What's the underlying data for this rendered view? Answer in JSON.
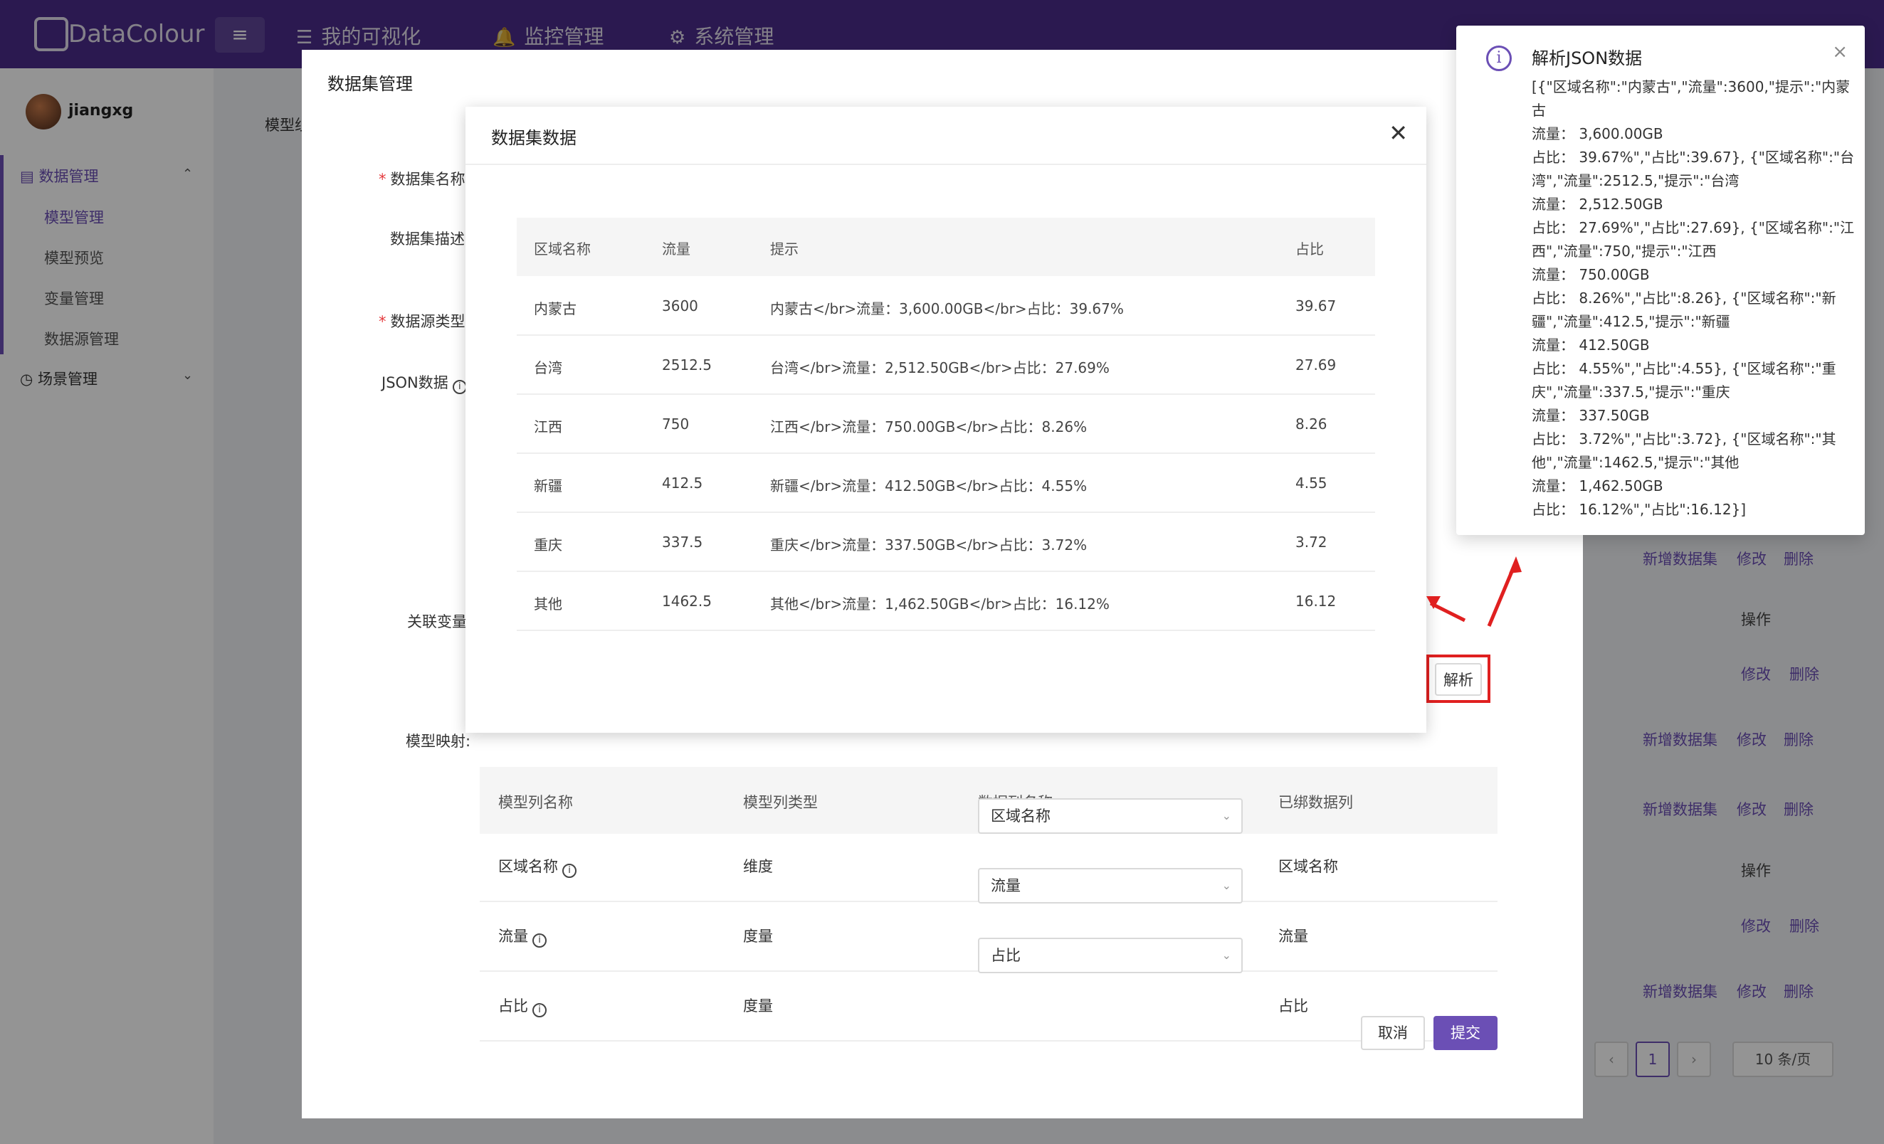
{
  "app": {
    "logo_text": "DataColour",
    "menu_toggle_icon": "≡",
    "nav": [
      {
        "icon": "☰",
        "label": "我的可视化"
      },
      {
        "icon": "🔔",
        "label": "监控管理"
      },
      {
        "icon": "⚙",
        "label": "系统管理"
      }
    ]
  },
  "sidebar": {
    "username": "jiangxg",
    "groups": [
      {
        "label": "数据管理",
        "icon": "▤"
      },
      {
        "label": "场景管理",
        "icon": "◷"
      }
    ],
    "items": [
      "模型管理",
      "模型预览",
      "变量管理",
      "数据源管理"
    ]
  },
  "background": {
    "breadcrumb": "模型组",
    "links": {
      "add_dataset": "新增数据集",
      "edit": "修改",
      "delete": "删除"
    },
    "op_header": "操作",
    "page": "1",
    "page_size": "10 条/页"
  },
  "outer_modal": {
    "title": "数据集管理",
    "labels": {
      "dataset_name": "数据集名称",
      "dataset_desc": "数据集描述",
      "datasource_type": "数据源类型",
      "json_data": "JSON数据",
      "related_var": "关联变量",
      "model_mapping": "模型映射:"
    },
    "parse_button": "解析",
    "mapping": {
      "headers": [
        "模型列名称",
        "模型列类型",
        "数据列名称",
        "已绑数据列"
      ],
      "rows": [
        {
          "name": "区域名称",
          "type": "维度",
          "select": "区域名称",
          "bound": "区域名称"
        },
        {
          "name": "流量",
          "type": "度量",
          "select": "流量",
          "bound": "流量"
        },
        {
          "name": "占比",
          "type": "度量",
          "select": "占比",
          "bound": "占比"
        }
      ]
    },
    "cancel": "取消",
    "submit": "提交"
  },
  "inner_modal": {
    "title": "数据集数据",
    "close": "✕",
    "headers": [
      "区域名称",
      "流量",
      "提示",
      "占比"
    ],
    "rows": [
      {
        "region": "内蒙古",
        "flow": "3600",
        "tip": "内蒙古</br>流量：3,600.00GB</br>占比：39.67%",
        "ratio": "39.67"
      },
      {
        "region": "台湾",
        "flow": "2512.5",
        "tip": "台湾</br>流量：2,512.50GB</br>占比：27.69%",
        "ratio": "27.69"
      },
      {
        "region": "江西",
        "flow": "750",
        "tip": "江西</br>流量：750.00GB</br>占比：8.26%",
        "ratio": "8.26"
      },
      {
        "region": "新疆",
        "flow": "412.5",
        "tip": "新疆</br>流量：412.50GB</br>占比：4.55%",
        "ratio": "4.55"
      },
      {
        "region": "重庆",
        "flow": "337.5",
        "tip": "重庆</br>流量：337.50GB</br>占比：3.72%",
        "ratio": "3.72"
      },
      {
        "region": "其他",
        "flow": "1462.5",
        "tip": "其他</br>流量：1,462.50GB</br>占比：16.12%",
        "ratio": "16.12"
      }
    ]
  },
  "notification": {
    "title": "解析JSON数据",
    "close": "×",
    "icon": "i",
    "lines": [
      "[{\"区域名称\":\"内蒙古\",\"流量\":3600,\"提示\":\"内蒙",
      "古",
      "流量： 3,600.00GB",
      "占比： 39.67%\",\"占比\":39.67}, {\"区域名称\":\"台",
      "湾\",\"流量\":2512.5,\"提示\":\"台湾",
      "流量： 2,512.50GB",
      "占比： 27.69%\",\"占比\":27.69}, {\"区域名称\":\"江",
      "西\",\"流量\":750,\"提示\":\"江西",
      "流量： 750.00GB",
      "占比： 8.26%\",\"占比\":8.26}, {\"区域名称\":\"新",
      "疆\",\"流量\":412.5,\"提示\":\"新疆",
      "流量： 412.50GB",
      "占比： 4.55%\",\"占比\":4.55}, {\"区域名称\":\"重",
      "庆\",\"流量\":337.5,\"提示\":\"重庆",
      "流量： 337.50GB",
      "占比： 3.72%\",\"占比\":3.72}, {\"区域名称\":\"其",
      "他\",\"流量\":1462.5,\"提示\":\"其他",
      "流量： 1,462.50GB",
      "占比： 16.12%\",\"占比\":16.12}]"
    ]
  },
  "colors": {
    "brand": "#4a2c8a",
    "accent": "#6b4fb5",
    "annotation": "#e02020"
  }
}
